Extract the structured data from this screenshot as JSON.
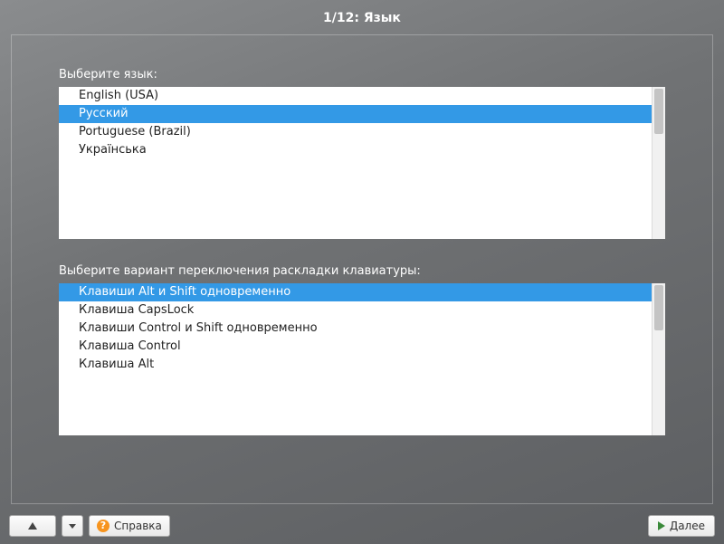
{
  "title": "1/12: Язык",
  "language": {
    "label": "Выберите язык:",
    "items": [
      {
        "label": "English (USA)",
        "selected": false
      },
      {
        "label": "Русский",
        "selected": true
      },
      {
        "label": "Portuguese (Brazil)",
        "selected": false
      },
      {
        "label": "Українська",
        "selected": false
      }
    ]
  },
  "keyboard": {
    "label": "Выберите вариант переключения раскладки клавиатуры:",
    "items": [
      {
        "label": "Клавиши Alt и Shift одновременно",
        "selected": true
      },
      {
        "label": "Клавиша CapsLock",
        "selected": false
      },
      {
        "label": "Клавиши Control и Shift одновременно",
        "selected": false
      },
      {
        "label": "Клавиша Control",
        "selected": false
      },
      {
        "label": "Клавиша Alt",
        "selected": false
      }
    ]
  },
  "buttons": {
    "help": "Справка",
    "next": "Далее"
  }
}
